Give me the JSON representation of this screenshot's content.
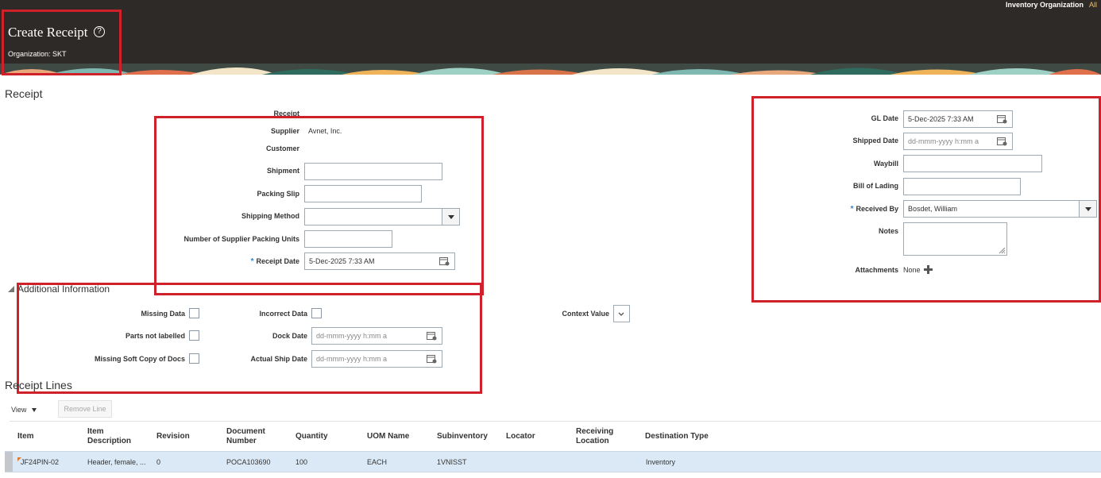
{
  "header": {
    "inventory_org_label": "Inventory Organization",
    "inventory_org_all": "All",
    "title": "Create Receipt",
    "organization": "Organization: SKT"
  },
  "receipt": {
    "section_title": "Receipt",
    "receipt_label": "Receipt",
    "supplier_label": "Supplier",
    "supplier_value": "Avnet, Inc.",
    "customer_label": "Customer",
    "shipment_label": "Shipment",
    "packing_slip_label": "Packing Slip",
    "shipping_method_label": "Shipping Method",
    "supplier_packing_units_label": "Number of Supplier Packing Units",
    "receipt_date_label": "Receipt Date",
    "receipt_date_value": "5-Dec-2025 7:33 AM",
    "gl_date_label": "GL Date",
    "gl_date_value": "5-Dec-2025 7:33 AM",
    "shipped_date_label": "Shipped Date",
    "shipped_date_placeholder": "dd-mmm-yyyy h:mm a",
    "waybill_label": "Waybill",
    "bill_of_lading_label": "Bill of Lading",
    "received_by_label": "Received By",
    "received_by_value": "Bosdet, William",
    "notes_label": "Notes",
    "attachments_label": "Attachments",
    "attachments_value": "None"
  },
  "additional": {
    "section_title": "Additional Information",
    "missing_data_label": "Missing Data",
    "parts_not_labelled_label": "Parts not labelled",
    "missing_soft_copy_label": "Missing Soft Copy of Docs",
    "incorrect_data_label": "Incorrect Data",
    "dock_date_label": "Dock Date",
    "dock_date_placeholder": "dd-mmm-yyyy h:mm a",
    "actual_ship_date_label": "Actual Ship Date",
    "actual_ship_date_placeholder": "dd-mmm-yyyy h:mm a",
    "context_value_label": "Context Value"
  },
  "lines": {
    "section_title": "Receipt Lines",
    "view_label": "View",
    "remove_line_label": "Remove Line",
    "columns": [
      "Item",
      "Item Description",
      "Revision",
      "Document Number",
      "Quantity",
      "UOM Name",
      "Subinventory",
      "Locator",
      "Receiving Location",
      "Destination Type"
    ],
    "rows": [
      {
        "item": "JF24PIN-02",
        "description": "Header, female, ...",
        "revision": "0",
        "document_number": "POCA103690",
        "quantity": "100",
        "uom": "EACH",
        "subinventory": "1VNISST",
        "locator": "",
        "receiving_location": "",
        "destination_type": "Inventory"
      }
    ]
  },
  "colors": {
    "header_bg": "#2e2a27",
    "highlight_red": "#d0202a",
    "required_blue": "#2f86d0",
    "selected_row": "#dbe9f6"
  }
}
